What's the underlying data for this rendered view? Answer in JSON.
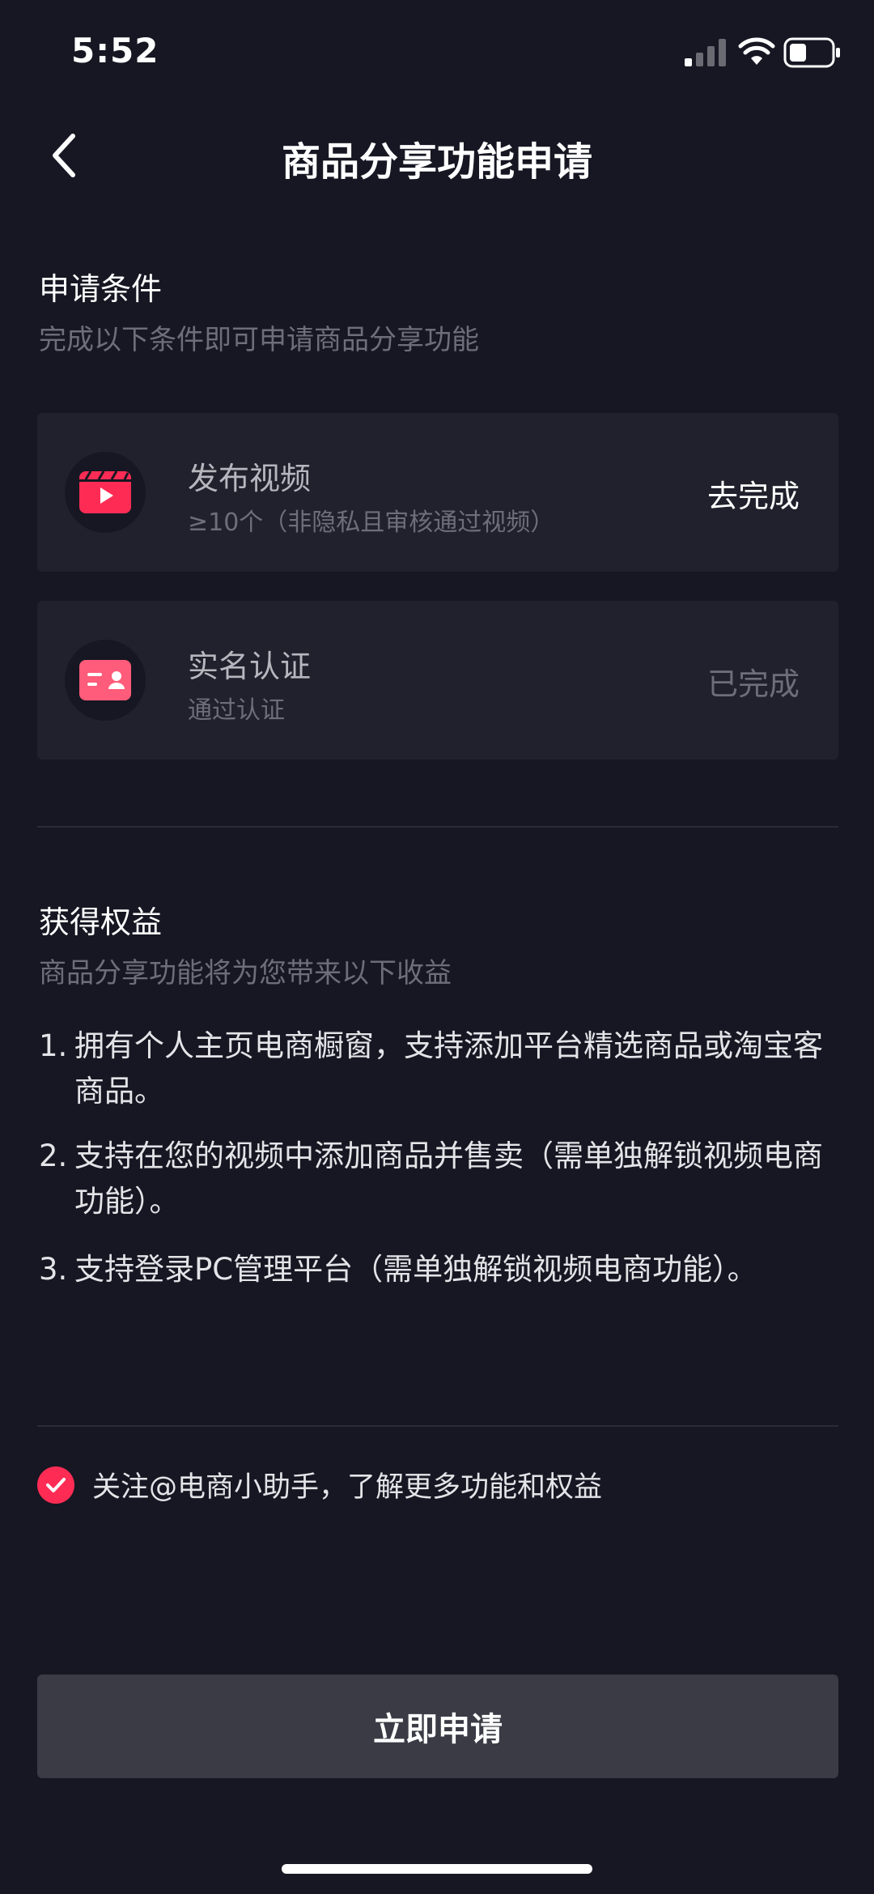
{
  "status_bar": {
    "time": "5:52"
  },
  "header": {
    "title": "商品分享功能申请"
  },
  "conditions": {
    "title": "申请条件",
    "subtitle": "完成以下条件即可申请商品分享功能",
    "items": [
      {
        "icon": "video-clapper-icon",
        "title": "发布视频",
        "desc": "≥10个（非隐私且审核通过视频）",
        "action": "去完成"
      },
      {
        "icon": "id-card-icon",
        "title": "实名认证",
        "desc": "通过认证",
        "action": "已完成"
      }
    ]
  },
  "benefits": {
    "title": "获得权益",
    "subtitle": "商品分享功能将为您带来以下收益",
    "items": [
      {
        "num": "1.",
        "text": "拥有个人主页电商橱窗，支持添加平台精选商品或淘宝客商品。"
      },
      {
        "num": "2.",
        "text": "支持在您的视频中添加商品并售卖（需单独解锁视频电商功能）。"
      },
      {
        "num": "3.",
        "text": "支持登录PC管理平台（需单独解锁视频电商功能）。"
      }
    ]
  },
  "follow": {
    "label": "关注@电商小助手，了解更多功能和权益",
    "checked": true
  },
  "apply_button": {
    "label": "立即申请"
  },
  "colors": {
    "background": "#161722",
    "card": "#20212c",
    "accent": "#fe2c55",
    "muted_text": "#6c6e7a",
    "button": "#3a3b45"
  }
}
